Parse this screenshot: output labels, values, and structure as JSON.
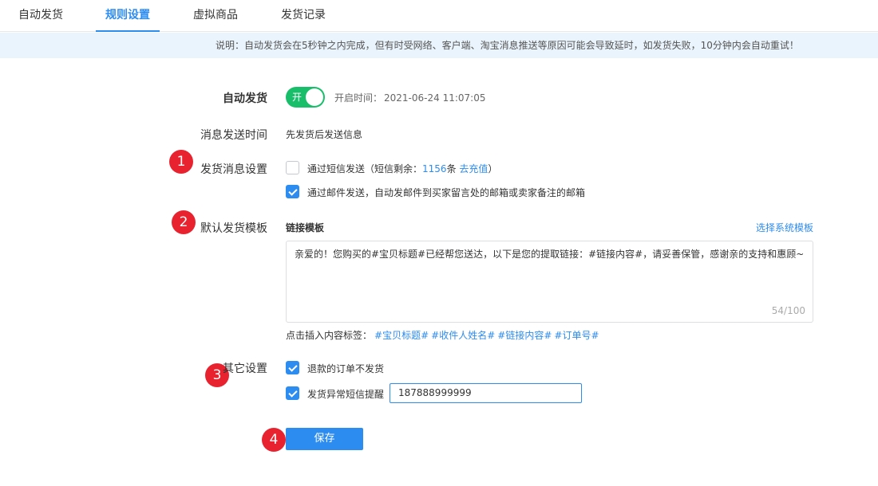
{
  "tabs": [
    {
      "label": "自动发货",
      "active": false
    },
    {
      "label": "规则设置",
      "active": true
    },
    {
      "label": "虚拟商品",
      "active": false
    },
    {
      "label": "发货记录",
      "active": false
    }
  ],
  "notice": "说明：自动发货会在5秒钟之内完成，但有时受网络、客户端、淘宝消息推送等原因可能会导致延时，如发货失败，10分钟内会自动重试！",
  "auto_ship": {
    "label": "自动发货",
    "toggle_text": "开",
    "enabled": true,
    "time_label": "开启时间：",
    "time_value": "2021-06-24 11:07:05"
  },
  "message_time": {
    "label": "消息发送时间",
    "value": "先发货后发送信息"
  },
  "ship_message": {
    "label": "发货消息设置",
    "sms": {
      "checked": false,
      "text_prefix": "通过短信发送（短信剩余：",
      "count": "1156",
      "unit": "条",
      "recharge": "去充值",
      "text_suffix": "）"
    },
    "email": {
      "checked": true,
      "text": "通过邮件发送，自动发邮件到买家留言处的邮箱或卖家备注的邮箱"
    }
  },
  "template": {
    "label": "默认发货模板",
    "title": "链接模板",
    "choose_system": "选择系统模板",
    "content": "亲爱的！您购买的#宝贝标题#已经帮您送达，以下是您的提取链接：#链接内容#，请妥善保管，感谢亲的支持和惠顾~",
    "count": "54/100",
    "insert_label": "点击插入内容标签：",
    "tags": [
      "#宝贝标题#",
      "#收件人姓名#",
      "#链接内容#",
      "#订单号#"
    ]
  },
  "other": {
    "label": "其它设置",
    "refund": {
      "checked": true,
      "text": "退款的订单不发货"
    },
    "abnormal": {
      "checked": true,
      "text": "发货异常短信提醒",
      "phone": "187888999999"
    }
  },
  "save_label": "保存",
  "steps": [
    "1",
    "2",
    "3",
    "4"
  ],
  "colors": {
    "primary": "#2d8cf0",
    "toggle_on": "#19be6b",
    "step_marker": "#e8232f",
    "notice_bg": "#eaf4fc"
  }
}
